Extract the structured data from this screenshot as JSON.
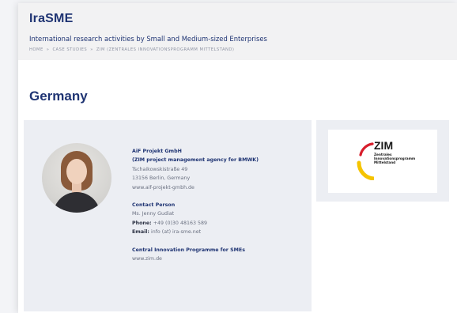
{
  "site": {
    "logo": "IraSME",
    "tagline": "International research activities by Small and Medium-sized Enterprises"
  },
  "breadcrumb": {
    "items": [
      "HOME",
      "CASE STUDIES",
      "ZIM (ZENTRALES INNOVATIONSPROGRAMM MITTELSTAND)"
    ],
    "separator": "»"
  },
  "page": {
    "title": "Germany"
  },
  "contact": {
    "org_name": "AiF Projekt GmbH",
    "org_role": "(ZIM project management agency for BMWK)",
    "street": "Tschaikowskistraße 49",
    "city": "13156 Berlin, Germany",
    "website": "www.aif-projekt-gmbh.de",
    "person_heading": "Contact Person",
    "person_name": "Ms. Jenny Gudiat",
    "phone_label": "Phone:",
    "phone": "+49 (0)30 48163 589",
    "email_label": "Email:",
    "email": "info (at) ira-sme.net",
    "programme_heading": "Central Innovation Programme for SMEs",
    "programme_url": "www.zim.de"
  },
  "zim_logo": {
    "title": "ZIM",
    "subtitle_lines": [
      "Zentrales",
      "Innovationsprogramm",
      "Mittelstand"
    ],
    "colors": {
      "red": "#d81e2c",
      "yellow": "#f5c400",
      "black": "#1a1a1a"
    }
  },
  "colors": {
    "brand": "#1f3473",
    "card": "#eceef3"
  }
}
